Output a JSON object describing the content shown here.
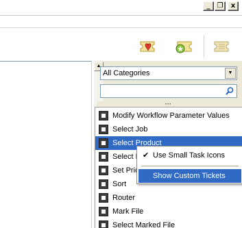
{
  "window": {
    "minimize_glyph": "_",
    "maximize_glyph": "❐",
    "close_glyph": "x"
  },
  "toolbar": {
    "icons": [
      "favorite-ticket-icon",
      "custom-ticket-add-icon",
      "ticket-icon"
    ]
  },
  "category_filter": {
    "selected": "All Categories"
  },
  "search": {
    "value": "",
    "placeholder": ""
  },
  "task_list": {
    "items": [
      {
        "label": "Modify Workflow Parameter Values",
        "icon": "workflow-params-icon"
      },
      {
        "label": "Select Job",
        "icon": "select-job-icon"
      },
      {
        "label": "Select Product",
        "icon": "select-product-icon",
        "selected": true
      },
      {
        "label": "Select P",
        "icon": "select-icon"
      },
      {
        "label": "Set Pric",
        "icon": "price-icon"
      },
      {
        "label": "Sort",
        "icon": "sort-icon"
      },
      {
        "label": "Router",
        "icon": "router-icon"
      },
      {
        "label": "Mark File",
        "icon": "mark-file-icon"
      },
      {
        "label": "Select Marked File",
        "icon": "select-marked-file-icon"
      }
    ]
  },
  "context_menu": {
    "items": [
      {
        "label": "Use Small Task Icons",
        "checked": true
      },
      {
        "label": "Show Custom Tickets",
        "highlighted": true
      }
    ]
  },
  "colors": {
    "selection": "#316ac5",
    "chrome": "#ece9d8",
    "border": "#7f9db9"
  }
}
